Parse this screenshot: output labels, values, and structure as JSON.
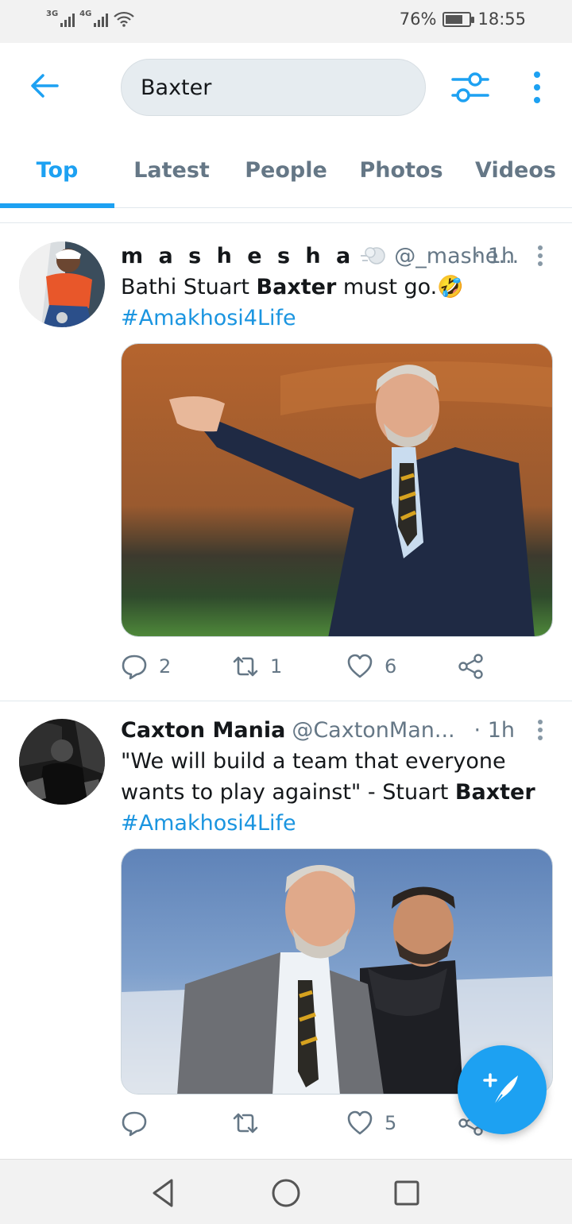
{
  "status_bar": {
    "signal1_label": "3G",
    "signal2_label": "4G",
    "battery_percent": "76%",
    "battery_level": 0.76,
    "time": "18:55"
  },
  "header": {
    "search_value": "Baxter",
    "back_icon": "arrow-left-icon",
    "filter_icon": "sliders-icon",
    "more_icon": "more-vertical-icon"
  },
  "tabs": [
    {
      "label": "Top",
      "active": true
    },
    {
      "label": "Latest",
      "active": false
    },
    {
      "label": "People",
      "active": false
    },
    {
      "label": "Photos",
      "active": false
    },
    {
      "label": "Videos",
      "active": false
    }
  ],
  "tweets": [
    {
      "display_name": "m a s h e s h a",
      "handle": "@_mashe...",
      "time": "· 1h",
      "text_pre": "Bathi Stuart ",
      "text_bold": "Baxter",
      "text_post": " must go.🤣",
      "hashtag": "#Amakhosi4Life",
      "replies": "2",
      "retweets": "1",
      "likes": "6"
    },
    {
      "display_name": "Caxton Mania",
      "handle": "@CaxtonMan...",
      "time": "· 1h",
      "text_pre": "\"We will build a team that everyone wants to play against\" - Stuart ",
      "text_bold": "Baxter",
      "text_post": "",
      "hashtag": "#Amakhosi4Life",
      "replies": "",
      "retweets": "",
      "likes": "5"
    }
  ],
  "colors": {
    "accent": "#1da1f2",
    "hashtag": "#1b95e0",
    "muted": "#657786"
  }
}
